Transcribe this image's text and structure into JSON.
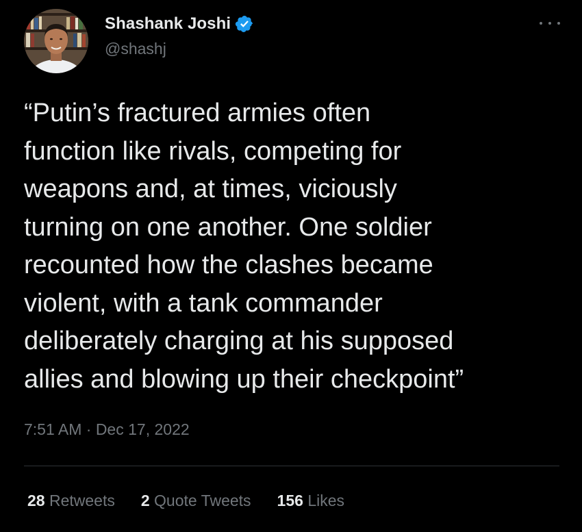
{
  "author": {
    "display_name": "Shashank Joshi",
    "handle": "@shashj",
    "verified": true,
    "verified_color": "#1d9bf0"
  },
  "menu": {
    "icon": "more-horizontal-icon"
  },
  "tweet": {
    "text_lines": [
      "“Putin’s fractured armies often",
      "function like rivals, competing for",
      "weapons and, at times, viciously",
      "turning on one another. One soldier",
      "recounted how the clashes became",
      "violent, with a tank commander",
      "deliberately charging at his supposed",
      "allies and blowing up their checkpoint”"
    ],
    "timestamp": "7:51 AM · Dec 17, 2022"
  },
  "stats": {
    "retweets": {
      "count": "28",
      "label": "Retweets"
    },
    "quotes": {
      "count": "2",
      "label": "Quote Tweets"
    },
    "likes": {
      "count": "156",
      "label": "Likes"
    }
  },
  "colors": {
    "background": "#000000",
    "text_primary": "#e7e9ea",
    "text_secondary": "#71767b",
    "divider": "#2f3336"
  }
}
